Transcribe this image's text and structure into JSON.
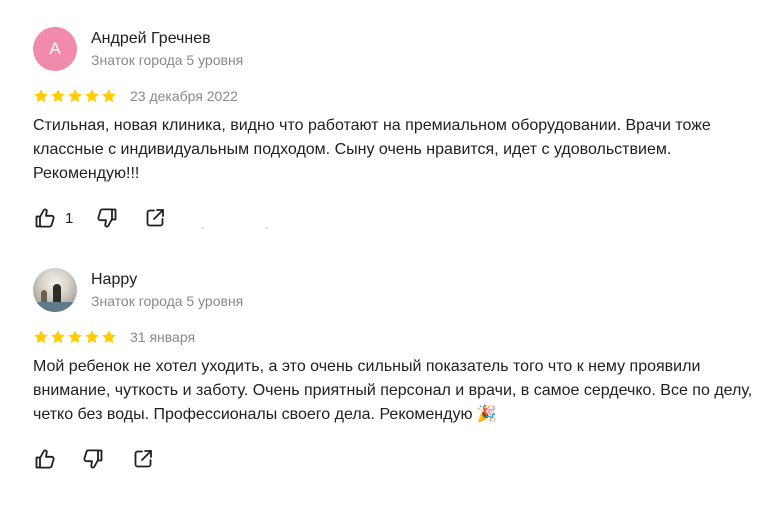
{
  "reviews": [
    {
      "author": {
        "name": "Андрей Гречнев",
        "level": "Знаток города 5 уровня",
        "initial": "А",
        "avatar_color": "#f28bab"
      },
      "rating": 5,
      "date": "23 декабря 2022",
      "text": "Стильная, новая клиника, видно что работают на премиальном оборудовании. Врачи тоже классные с индивидуальным подходом. Сыну очень нравится, идет с удовольствием. Рекомендую!!!",
      "likes": "1",
      "actions": {
        "like_icon": "thumbs-up-icon",
        "dislike_icon": "thumbs-down-icon",
        "share_icon": "share-icon"
      }
    },
    {
      "author": {
        "name": "Happy",
        "level": "Знаток города 5 уровня",
        "avatar": "photo"
      },
      "rating": 5,
      "date": "31 января",
      "text": "Мой ребенок не хотел уходить, а это очень сильный показатель того что к нему проявили внимание, чуткость и заботу. Очень приятный персонал и врачи, в самое сердечко. Все по делу, четко без воды. Профессионалы своего дела. Рекомендую 🎉",
      "likes": "",
      "actions": {
        "like_icon": "thumbs-up-icon",
        "dislike_icon": "thumbs-down-icon",
        "share_icon": "share-icon"
      }
    }
  ],
  "colors": {
    "star": "#fc0",
    "secondary_text": "#898989",
    "primary_text": "#21201f"
  }
}
